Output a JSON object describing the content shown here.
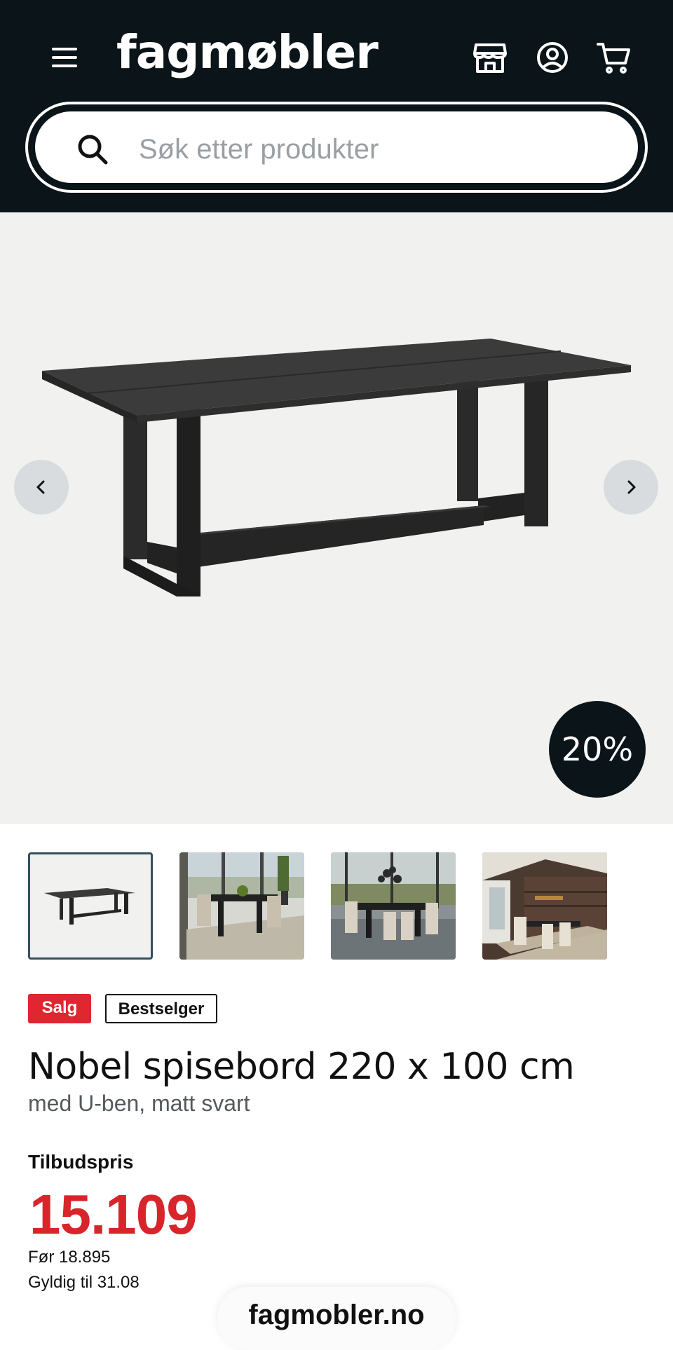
{
  "header": {
    "logo": "fagmøbler",
    "search_placeholder": "Søk etter produkter"
  },
  "hero": {
    "discount_badge": "20%"
  },
  "thumbnails": [
    {
      "name": "product-photo",
      "selected": true
    },
    {
      "name": "lakeside-dining-room-photo",
      "selected": false
    },
    {
      "name": "glass-wall-dining-room-photo",
      "selected": false
    },
    {
      "name": "cabin-dining-room-photo",
      "selected": false
    }
  ],
  "product": {
    "tags": {
      "sale": "Salg",
      "bestseller": "Bestselger"
    },
    "title": "Nobel spisebord 220 x 100 cm",
    "subtitle": "med U-ben, matt svart",
    "price_label": "Tilbudspris",
    "price": "15.109",
    "before_price": "Før 18.895",
    "valid_until": "Gyldig til 31.08"
  },
  "footer": {
    "domain": "fagmobler.no"
  },
  "colors": {
    "header_bg": "#0b1418",
    "sale_red": "#e0262e",
    "price_red": "#d8242b",
    "hero_bg": "#f1f1ef"
  }
}
